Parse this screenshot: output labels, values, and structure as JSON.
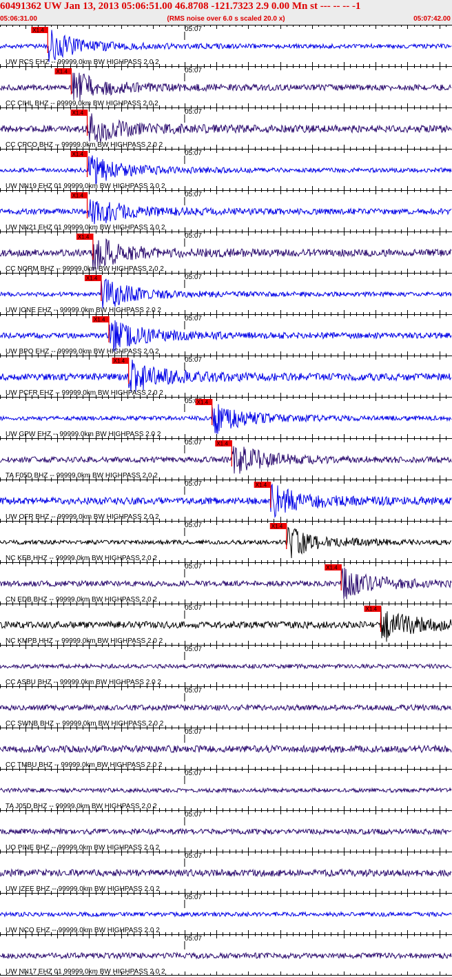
{
  "header": {
    "title": "60491362 UW Jan 13, 2013 05:06:51.00   46.8708 -121.7323  2.9 0.00 Mn st --- -- --   -1",
    "start_time": "05:06:31.00",
    "end_time": "05:07:42.00",
    "scale_note": "(RMS noise over 6.0 s scaled 20.0 x)"
  },
  "colors": {
    "header_text": "#dd0000",
    "header_bg": "#ececec",
    "pick_marker": "#ee0000",
    "trace_blue": "#0000e6",
    "trace_purple": "#2a0a6e",
    "trace_black": "#000000"
  },
  "chart_data": {
    "type": "line",
    "time_range": [
      "05:06:31.00",
      "05:07:42.00"
    ],
    "minute_mark_label": "05:07",
    "pick_label": "X1.4",
    "series": [
      {
        "label": "UW RCS EHZ -- 99999.0km BW  HIGHPASS  2.0  2",
        "pick_time": "05:06:38.5",
        "color": "trace_blue"
      },
      {
        "label": "CC CIHL BHZ -- 99999.0km BW  HIGHPASS  2.0  2",
        "pick_time": "05:06:42.2",
        "color": "trace_purple"
      },
      {
        "label": "CC CPCO BHZ -- 99999.0km BW  HIGHPASS  2.0  2",
        "pick_time": "05:06:44.7",
        "color": "trace_purple"
      },
      {
        "label": "UW NN19 EHZ 01 99999.0km BW  HIGHPASS  2.0  2",
        "pick_time": "05:06:44.7",
        "color": "trace_blue"
      },
      {
        "label": "UW NN21 EHZ 01 99999.0km BW  HIGHPASS  2.0  2",
        "pick_time": "05:06:44.7",
        "color": "trace_blue"
      },
      {
        "label": "CC NORM BHZ -- 99999.0km BW  HIGHPASS  2.0  2",
        "pick_time": "05:06:45.6",
        "color": "trace_purple"
      },
      {
        "label": "UW IONE EHZ -- 99999.0km BW  HIGHPASS  2.0  2",
        "pick_time": "05:06:46.9",
        "color": "trace_blue"
      },
      {
        "label": "UW BPO EHZ -- 99999.0km BW  HIGHPASS  2.0  2",
        "pick_time": "05:06:48.1",
        "color": "trace_blue"
      },
      {
        "label": "UW PCFR EHZ -- 99999.0km BW  HIGHPASS  2.0  2",
        "pick_time": "05:06:51.2",
        "color": "trace_blue"
      },
      {
        "label": "UW GPW EHZ -- 99999.0km BW  HIGHPASS  2.0  2",
        "pick_time": "05:07:04.3",
        "color": "trace_blue"
      },
      {
        "label": "TA F05D BHZ -- 99999.0km BW  HIGHPASS  2.0  2",
        "pick_time": "05:07:07.4",
        "color": "trace_purple"
      },
      {
        "label": "UW OFR BHZ -- 99999.0km BW  HIGHPASS  2.0  2",
        "pick_time": "05:07:13.5",
        "color": "trace_blue"
      },
      {
        "label": "NC KEB HHZ -- 99999.0km BW  HIGHPASS  2.0  2",
        "pick_time": "05:07:16.0",
        "color": "trace_black"
      },
      {
        "label": "CN EDB BHZ -- 99999.0km BW  HIGHPASS  2.0  2",
        "pick_time": "05:07:24.6",
        "color": "trace_purple"
      },
      {
        "label": "NC KMPB HHZ -- 99999.0km BW  HIGHPASS  2.0  2",
        "pick_time": "05:07:30.8",
        "color": "trace_black"
      },
      {
        "label": "CC ASBU BHZ -- 99999.0km BW  HIGHPASS  2.0  2",
        "pick_time": null,
        "color": "trace_purple"
      },
      {
        "label": "CC SWNB BHZ -- 99999.0km BW  HIGHPASS  2.0  2",
        "pick_time": null,
        "color": "trace_purple"
      },
      {
        "label": "CC TMBU BHZ -- 99999.0km BW  HIGHPASS  2.0  2",
        "pick_time": null,
        "color": "trace_purple"
      },
      {
        "label": "TA J05D BHZ -- 99999.0km BW  HIGHPASS  2.0  2",
        "pick_time": null,
        "color": "trace_purple"
      },
      {
        "label": "UO PINE BHZ -- 99999.0km BW  HIGHPASS  2.0  2",
        "pick_time": null,
        "color": "trace_purple"
      },
      {
        "label": "UW IZEE BHZ -- 99999.0km BW  HIGHPASS  2.0  2",
        "pick_time": null,
        "color": "trace_purple"
      },
      {
        "label": "UW NCO EHZ -- 99999.0km BW  HIGHPASS  2.0  2",
        "pick_time": null,
        "color": "trace_blue"
      },
      {
        "label": "UW NN17 EHZ 01 99999.0km BW  HIGHPASS  2.0  2",
        "pick_time": null,
        "color": "trace_purple"
      }
    ]
  }
}
